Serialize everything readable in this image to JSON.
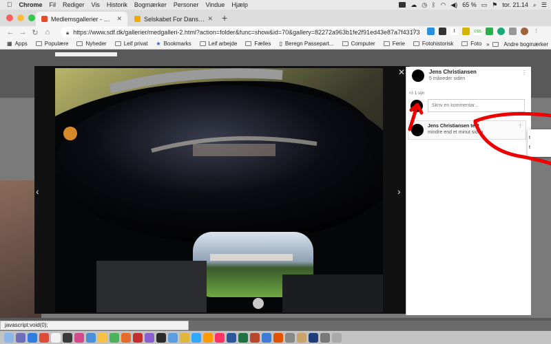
{
  "menubar": {
    "items": [
      "Chrome",
      "Fil",
      "Rediger",
      "Vis",
      "Historik",
      "Bogmærker",
      "Personer",
      "Vindue",
      "Hjælp"
    ],
    "battery": "65 %",
    "clock": "tor. 21.14"
  },
  "tabs": [
    {
      "label": "Medlemsgallerier - Selskabet fo",
      "favicon_color": "#e34b2a"
    },
    {
      "label": "Selskabet For Dansk Fotografi",
      "favicon_color": "#f2a900"
    }
  ],
  "address": {
    "url": "https://www.sdf.dk/gallerier/medgalleri-2.html?action=folder&func=show&id=70&gallery=82272a963b1fe2f91ed43e87a7f43173&r..."
  },
  "bookmarks": {
    "items": [
      {
        "label": "Apps",
        "icon": "apps-grid-icon"
      },
      {
        "label": "Populære",
        "icon": "folder-icon"
      },
      {
        "label": "Nyheder",
        "icon": "folder-icon"
      },
      {
        "label": "Leif privat",
        "icon": "folder-icon"
      },
      {
        "label": "Bookmarks",
        "icon": "star-icon"
      },
      {
        "label": "Leif arbejde",
        "icon": "folder-icon"
      },
      {
        "label": "Fælles",
        "icon": "folder-icon"
      },
      {
        "label": "Beregn Passepart...",
        "icon": "page-icon"
      },
      {
        "label": "Computer",
        "icon": "folder-icon"
      },
      {
        "label": "Ferie",
        "icon": "folder-icon"
      },
      {
        "label": "Fotohistorisk",
        "icon": "folder-icon"
      },
      {
        "label": "Foto",
        "icon": "folder-icon"
      }
    ],
    "other": "Andre bogmærker"
  },
  "post": {
    "author": "Jens Christiansen",
    "time": "5 måneder siden"
  },
  "likes": "1 syn",
  "comment_placeholder": "Skriv en kommentar...",
  "comment": {
    "author": "Jens Christiansen test",
    "text": "mindre end et minut siden"
  },
  "popup_items": [
    "t",
    "t"
  ],
  "status": "javascript:void(0);",
  "colors": {
    "annotation": "#ee0000",
    "mac_red": "#fc605c",
    "mac_yellow": "#fdbc40",
    "mac_green": "#34c84a"
  }
}
